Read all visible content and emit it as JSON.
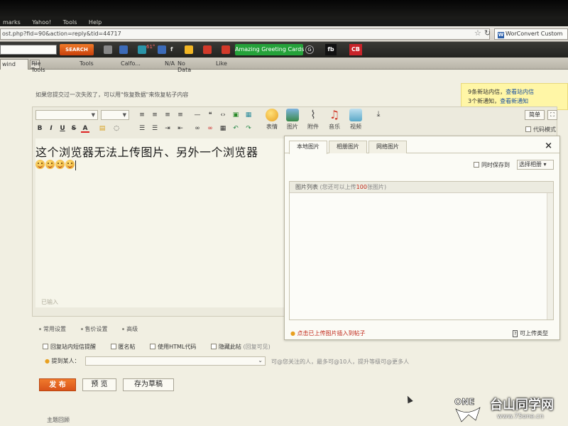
{
  "browser": {
    "menu": [
      "marks",
      "Yahoo!",
      "Tools",
      "Help"
    ],
    "url": "ost.php?fid=90&action=reply&tid=44717",
    "search_engine_label": "WorConvert Custom",
    "search_button": "SEARCH",
    "tb_counter": "61°",
    "file_tools": "File Tools",
    "tools": "Tools",
    "calc_field": "Calfo...",
    "na_label": "N/A",
    "no_data": "No Data",
    "like": "Like",
    "greeting": "Amazing Greeting Cards",
    "fb": "fb",
    "cb": "CB",
    "tab_label": "wind",
    "new_tab": "+"
  },
  "page": {
    "restore_tip": "如果您提交过一次失败了，可以用\"恢复数据\"来恢复帖子内容",
    "notice": {
      "line1_prefix": "9条新站内信，",
      "line1_link": "查看站内信",
      "line2_prefix": "3个新通知，",
      "line2_link": "查看新通知"
    }
  },
  "editor": {
    "toolbar_big": [
      "表情",
      "图片",
      "附件",
      "音乐",
      "视频"
    ],
    "simple_label": "简单",
    "fullscreen_label": "⛶",
    "code_mode": "代码模式",
    "format_buttons": [
      "B",
      "I",
      "U",
      "S",
      "A"
    ],
    "content": "这个浏览器无法上传图片、另外一个浏览器",
    "word_count": "已输入"
  },
  "image_popup": {
    "tabs": [
      "本地图片",
      "相册图片",
      "网络图片"
    ],
    "close": "×",
    "sync_save": "同时保存到",
    "album_select": "选择相册",
    "list_title": "图片列表",
    "list_hint_prefix": "(您还可以上传",
    "list_hint_count": "100",
    "list_hint_suffix": "张图片)",
    "insert_uploaded": "点击已上传图片插入到帖子",
    "upload_types": "可上传类型"
  },
  "options": {
    "tabs": [
      "常用设置",
      "售价设置",
      "高级"
    ],
    "checkboxes": [
      "回复站内短信提醒",
      "匿名帖",
      "使用HTML代码",
      "隐藏此帖"
    ],
    "hidden_note": "(回复可见)",
    "mention_label": "提到某人：",
    "mention_hint": "可@您关注的人，最多可@10人，提升等级可@更多人"
  },
  "actions": {
    "publish": "发 布",
    "preview": "预 览",
    "save_draft": "存为草稿"
  },
  "footer": {
    "topic_reply": "主题回顾"
  },
  "watermark": {
    "logo_text": "ONE",
    "site": "台山同学网",
    "url": "www.75one.cn"
  }
}
